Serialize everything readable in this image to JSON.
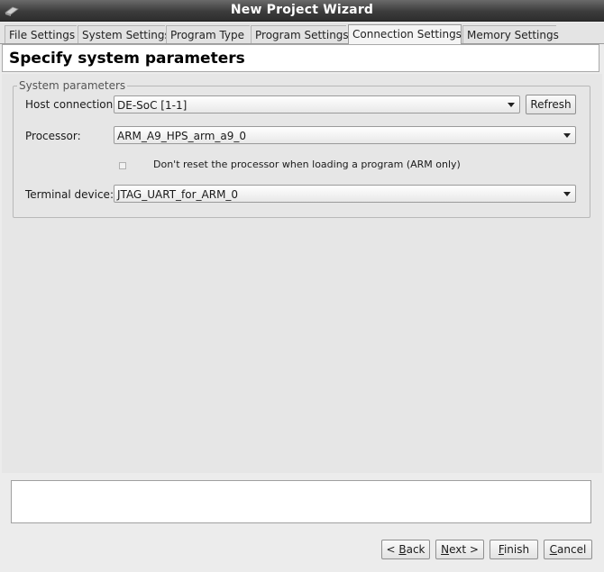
{
  "window": {
    "title": "New Project Wizard"
  },
  "tabs": [
    {
      "label": "File Settings"
    },
    {
      "label": "System Settings"
    },
    {
      "label": "Program Type"
    },
    {
      "label": "Program Settings"
    },
    {
      "label": "Connection Settings",
      "active": true
    },
    {
      "label": "Memory Settings"
    }
  ],
  "header": {
    "title": "Specify system parameters"
  },
  "system_params": {
    "group_label": "System parameters",
    "host_connection": {
      "label": "Host connection:",
      "value": "DE-SoC [1-1]"
    },
    "refresh_label": "Refresh",
    "processor": {
      "label": "Processor:",
      "value": "ARM_A9_HPS_arm_a9_0"
    },
    "no_reset": {
      "label": "Don't reset the processor when loading a program (ARM only)",
      "checked": false
    },
    "terminal_device": {
      "label": "Terminal device:",
      "value": "JTAG_UART_for_ARM_0"
    }
  },
  "message": "",
  "buttons": {
    "back": {
      "prefix": "< ",
      "mnemonic": "B",
      "rest": "ack"
    },
    "next": {
      "prefix": "",
      "mnemonic": "N",
      "rest": "ext >"
    },
    "finish": {
      "prefix": "",
      "mnemonic": "F",
      "rest": "inish"
    },
    "cancel": {
      "prefix": "",
      "mnemonic": "C",
      "rest": "ancel"
    }
  }
}
